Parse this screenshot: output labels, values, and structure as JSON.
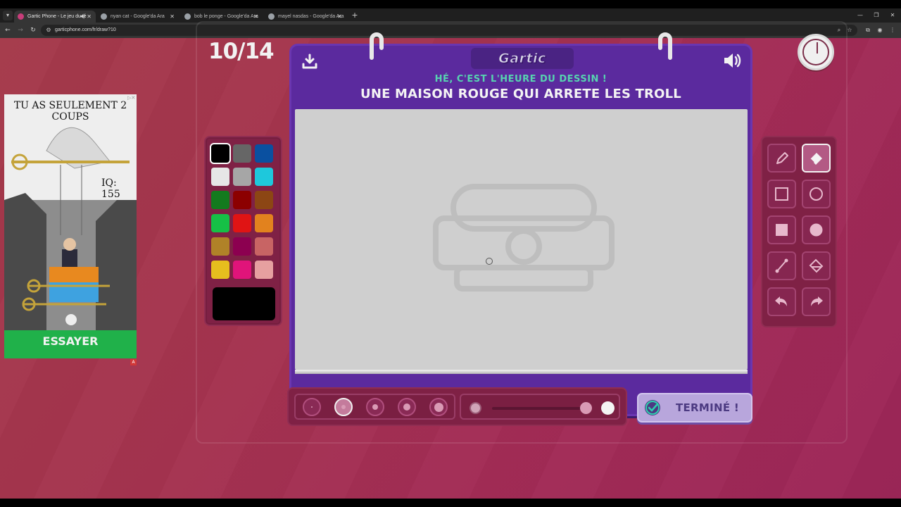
{
  "browser": {
    "tabs": [
      {
        "title": "Gartic Phone - Le jeu du té",
        "active": true,
        "favicon_color": "#c83d7a"
      },
      {
        "title": "nyan cat - Google'da Ara",
        "active": false,
        "favicon_color": "#9aa0a6"
      },
      {
        "title": "bob le ponge - Google'da Ara",
        "active": false,
        "favicon_color": "#9aa0a6"
      },
      {
        "title": "mayel nasdas - Google'da Ara",
        "active": false,
        "favicon_color": "#9aa0a6"
      }
    ],
    "url": "garticphone.com/fr/draw?10"
  },
  "game": {
    "round": "10/14",
    "logo": "Gartic",
    "subtitle": "HÉ, C'EST L'HEURE DU DESSIN !",
    "prompt": "UNE MAISON ROUGE QUI ARRETE LES TROLL",
    "done_label": "TERMINÉ !",
    "selected_color": "#000000",
    "palette": [
      "#000000",
      "#666666",
      "#0a50a0",
      "#e6e6e6",
      "#a6a6a6",
      "#1ec8dc",
      "#137a1e",
      "#8c0000",
      "#8c4614",
      "#16c046",
      "#e01414",
      "#e2821e",
      "#b08228",
      "#8c0050",
      "#c86464",
      "#e6be1e",
      "#e0147a",
      "#e6a0a0"
    ],
    "tools": [
      {
        "name": "pencil-tool",
        "active": false
      },
      {
        "name": "eraser-tool",
        "active": true
      },
      {
        "name": "rectangle-outline-tool",
        "active": false
      },
      {
        "name": "ellipse-outline-tool",
        "active": false
      },
      {
        "name": "rectangle-fill-tool",
        "active": false
      },
      {
        "name": "ellipse-fill-tool",
        "active": false
      },
      {
        "name": "line-tool",
        "active": false
      },
      {
        "name": "fill-bucket-tool",
        "active": false
      },
      {
        "name": "undo-tool",
        "active": false
      },
      {
        "name": "redo-tool",
        "active": false
      }
    ],
    "brush_sizes": [
      1,
      2,
      3,
      4,
      5
    ],
    "selected_brush_size": 2,
    "opacity": 1.0
  },
  "ad": {
    "title": "TU AS SEULEMENT 2 COUPS",
    "iq": "IQ: 155",
    "cta": "ESSAYER",
    "badge": "A"
  }
}
